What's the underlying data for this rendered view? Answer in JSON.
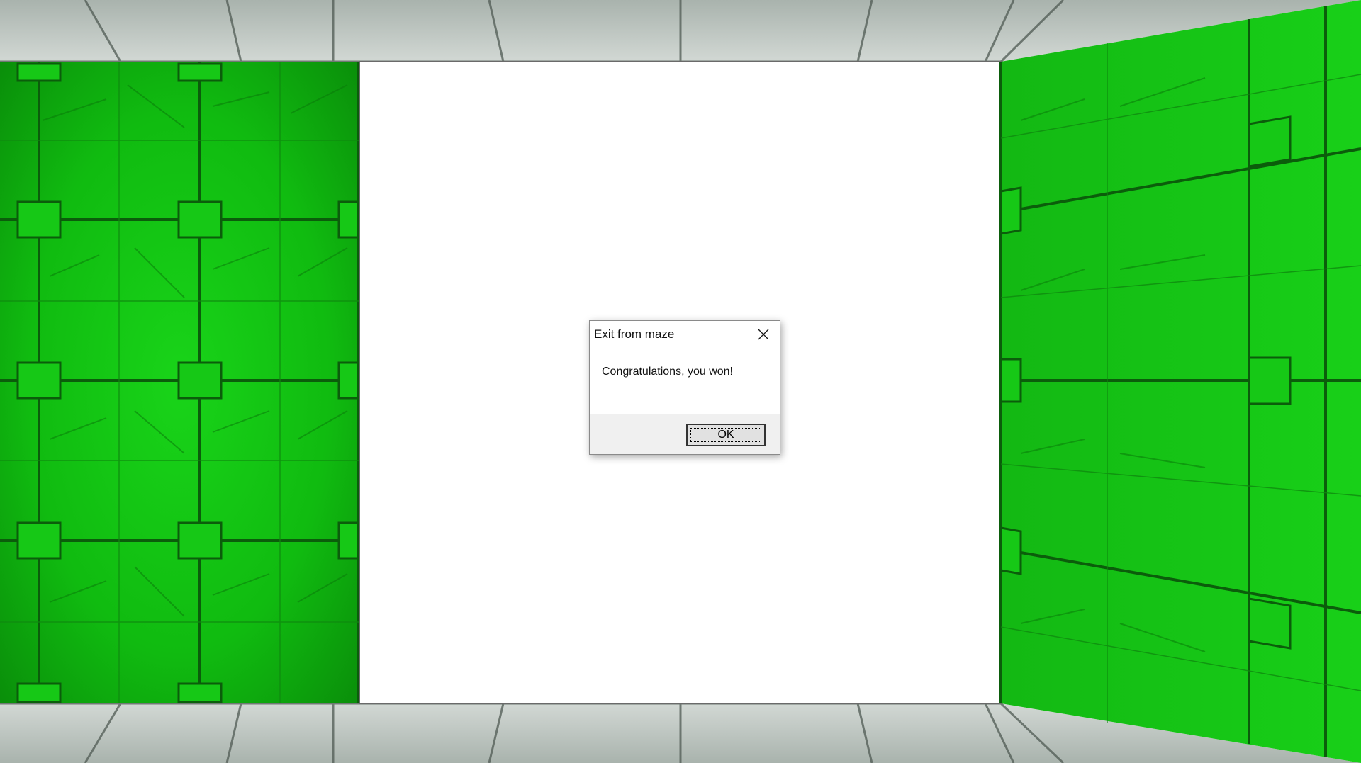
{
  "scene": {
    "description_colors": {
      "wall": "#12c412",
      "wall_dark": "#0a6a0a",
      "wall_line": "#0b5d0b",
      "ceiling_floor": "#b9c2bc",
      "ceiling_floor_dark": "#6e7a72",
      "opening": "#ffffff"
    }
  },
  "dialog": {
    "title": "Exit from maze",
    "message": "Congratulations, you won!",
    "ok_label": "OK",
    "close_icon": "close-icon"
  }
}
